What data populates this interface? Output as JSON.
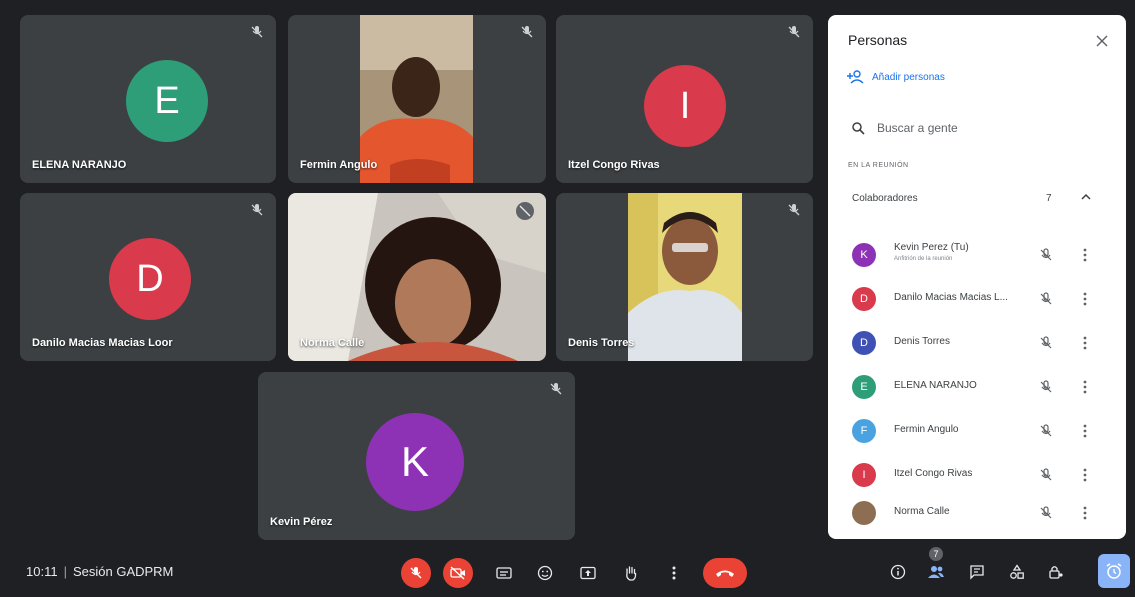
{
  "meeting": {
    "time": "10:11",
    "separator": "|",
    "name": "Sesión GADPRM"
  },
  "tiles": [
    {
      "name": "ELENA NARANJO",
      "initial": "E",
      "avatar_color": "#2e9e78"
    },
    {
      "name": "Fermin Angulo"
    },
    {
      "name": "Itzel Congo Rivas",
      "initial": "I",
      "avatar_color": "#d93a4c"
    },
    {
      "name": "Danilo Macias Macias Loor",
      "initial": "D",
      "avatar_color": "#d93a4c"
    },
    {
      "name": "Norma Calle"
    },
    {
      "name": "Denis Torres"
    },
    {
      "name": "Kevin Pérez",
      "initial": "K",
      "avatar_color": "#8e32b5"
    }
  ],
  "controls": {
    "people_count": "7"
  },
  "panel": {
    "title": "Personas",
    "add_people_label": "Añadir personas",
    "search_placeholder": "Buscar a gente",
    "section_label": "EN LA REUNIÓN",
    "group": {
      "name": "Colaboradores",
      "count": "7"
    },
    "participants": [
      {
        "name": "Kevin Perez (Tu)",
        "subtitle": "Anfitrión de la reunión",
        "initial": "K",
        "color": "#8e32b5"
      },
      {
        "name": "Danilo Macias Macias L...",
        "initial": "D",
        "color": "#d93a4c"
      },
      {
        "name": "Denis Torres",
        "initial": "D",
        "color": "#3f51b5"
      },
      {
        "name": "ELENA NARANJO",
        "initial": "E",
        "color": "#2e9e78"
      },
      {
        "name": "Fermin Angulo",
        "initial": "F",
        "color": "#4aa3e0"
      },
      {
        "name": "Itzel Congo Rivas",
        "initial": "I",
        "color": "#d93a4c"
      },
      {
        "name": "Norma Calle",
        "initial": "",
        "color": "#8d6e53"
      }
    ]
  },
  "colors": {
    "tile_background": "#3c4043",
    "page_background": "#1f2023",
    "end_call_red": "#ea4335",
    "accent_blue": "#1a73e8"
  }
}
